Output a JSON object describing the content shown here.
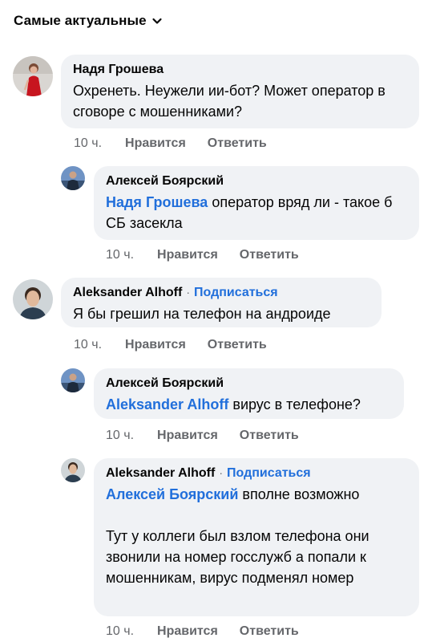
{
  "sort": {
    "label": "Самые актуальные",
    "icon": "chevron-down-icon"
  },
  "actions": {
    "like": "Нравится",
    "reply": "Ответить"
  },
  "colors": {
    "bubble": "#f0f2f5",
    "link": "#216fdb",
    "meta": "#65676b",
    "text": "#050505"
  },
  "comments": [
    {
      "author": "Надя Грошева",
      "text": "Охренеть. Неужели ии-бот? Может оператор в сговоре с мошенниками?",
      "time": "10 ч."
    },
    {
      "author": "Алексей Боярский",
      "mention": "Надя Грошева",
      "text": " оператор вряд ли - такое б СБ засекла",
      "time": "10 ч."
    },
    {
      "author": "Aleksander Alhoff",
      "dot": "·",
      "follow": "Подписаться",
      "text": "Я бы грешил на телефон на андроиде",
      "time": "10 ч."
    },
    {
      "author": "Алексей Боярский",
      "mention": "Aleksander Alhoff",
      "text": " вирус в телефоне?",
      "time": "10 ч."
    },
    {
      "author": "Aleksander Alhoff",
      "dot": "·",
      "follow": "Подписаться",
      "mention": "Алексей Боярский",
      "text_line1": " вполне возможно",
      "text": "Тут у коллеги был взлом телефона они звонили на номер госслужб а попали к мошенникам, вирус подменял номер",
      "time": "10 ч."
    }
  ]
}
